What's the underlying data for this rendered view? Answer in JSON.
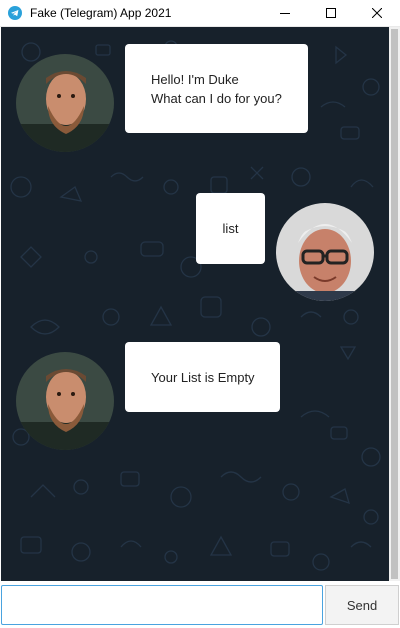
{
  "window": {
    "title": "Fake (Telegram) App 2021"
  },
  "messages": [
    {
      "sender": "duke",
      "text": "Hello! I'm Duke\nWhat can I do for you?"
    },
    {
      "sender": "user",
      "text": "list"
    },
    {
      "sender": "duke",
      "text": "Your List is Empty"
    }
  ],
  "input": {
    "value": "",
    "placeholder": ""
  },
  "send_label": "Send",
  "icons": {
    "app": "telegram-icon",
    "minimize": "minimize-icon",
    "maximize": "maximize-icon",
    "close": "close-icon"
  },
  "colors": {
    "chat_background": "#17212b",
    "bubble": "#ffffff",
    "input_focus_border": "#4aa3df",
    "telegram_blue": "#2aa1da"
  }
}
